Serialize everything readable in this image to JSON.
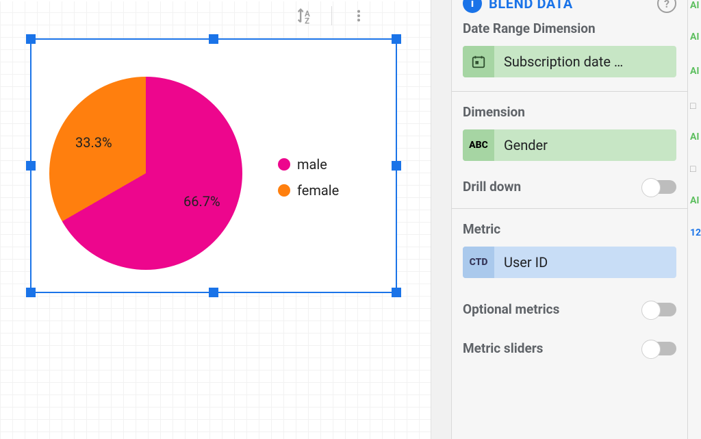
{
  "colors": {
    "male": "#ed068d",
    "female": "#ff7f0e"
  },
  "chart_data": {
    "type": "pie",
    "series": [
      {
        "name": "male",
        "value": 66.7,
        "label": "66.7%",
        "color": "#ed068d"
      },
      {
        "name": "female",
        "value": 33.3,
        "label": "33.3%",
        "color": "#ff7f0e"
      }
    ],
    "legend_position": "right"
  },
  "legend": {
    "items": [
      {
        "label": "male"
      },
      {
        "label": "female"
      }
    ]
  },
  "panel": {
    "blend": {
      "title": "BLEND DATA",
      "info_badge_icon": "i",
      "help_icon": "?"
    },
    "date_range": {
      "title": "Date Range Dimension",
      "chip_label": "Subscription date …",
      "chip_icon": "calendar"
    },
    "dimension": {
      "title": "Dimension",
      "chip_label": "Gender",
      "chip_icon": "ABC",
      "drill_down_label": "Drill down"
    },
    "metric": {
      "title": "Metric",
      "chip_label": "User ID",
      "chip_icon": "CTD",
      "optional_label": "Optional metrics",
      "sliders_label": "Metric sliders"
    }
  },
  "right_rail": {
    "items": [
      "AI",
      "AI",
      "AI",
      "□",
      "AI",
      "□",
      "AI",
      "12"
    ]
  }
}
